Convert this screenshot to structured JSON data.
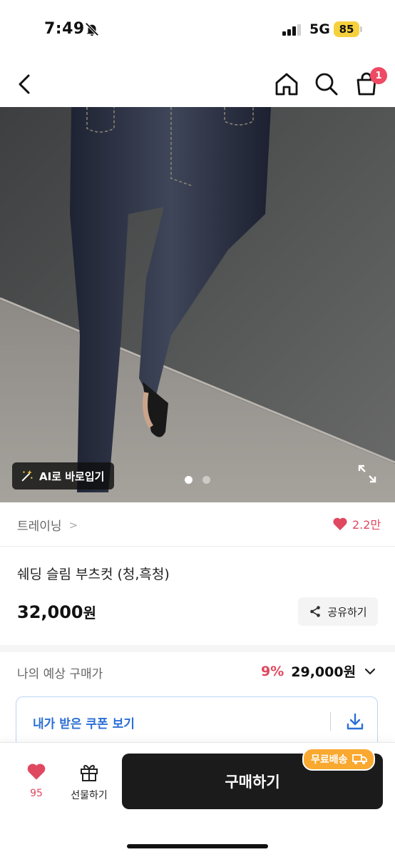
{
  "status_bar": {
    "time": "7:49",
    "network": "5G",
    "battery": "85"
  },
  "header": {
    "cart_badge": "1"
  },
  "image": {
    "ai_button_label": "AI로 바로입기",
    "page_count": 2,
    "current_page": 1
  },
  "brand": {
    "name": "트레이닝",
    "chevron": ">"
  },
  "likes": {
    "count": "2.2만"
  },
  "product": {
    "title": "쉐딩 슬림 부츠컷 (청,흑청)",
    "price": "32,000",
    "price_unit": "원"
  },
  "share": {
    "label": "공유하기"
  },
  "estimate": {
    "label": "나의 예상 구매가",
    "discount": "9%",
    "price": "29,000원"
  },
  "coupon": {
    "label": "내가 받은 쿠폰 보기"
  },
  "bottom_bar": {
    "like_count": "95",
    "gift_label": "선물하기",
    "buy_label": "구매하기",
    "free_shipping_label": "무료배송"
  },
  "colors": {
    "accent_red": "#e0485f",
    "coupon_blue": "#2b6fd6",
    "buy_black": "#1b1b1b",
    "shipping_orange": "#f9a830",
    "battery_yellow": "#f6d13d"
  },
  "icons": [
    "bell-off-icon",
    "signal-icon",
    "back-icon",
    "home-icon",
    "search-icon",
    "shopping-bag-icon",
    "magic-wand-icon",
    "expand-icon",
    "chevron-right-icon",
    "heart-icon",
    "share-icon",
    "chevron-down-icon",
    "download-icon",
    "gift-icon",
    "truck-icon"
  ]
}
